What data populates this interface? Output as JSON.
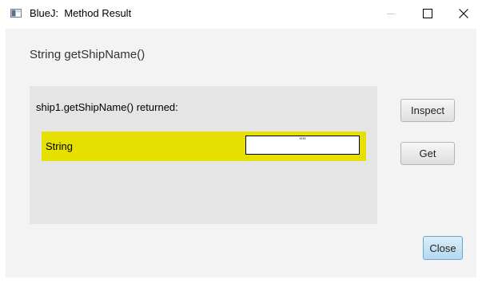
{
  "window": {
    "title": "BlueJ:  Method Result",
    "icon": "bluej-app-icon"
  },
  "titlebar_controls": {
    "minimize_icon": "minimize-icon",
    "maximize_icon": "maximize-icon",
    "close_icon": "close-icon"
  },
  "dialog": {
    "method_signature": "String getShipName()",
    "returned_label": "ship1.getShipName() returned:",
    "result": {
      "type": "String",
      "value": "\"\""
    },
    "buttons": {
      "inspect": "Inspect",
      "get": "Get",
      "close": "Close"
    }
  },
  "colors": {
    "result_highlight": "#e6e000",
    "panel_background": "#e5e5e5",
    "client_background": "#f3f3f3",
    "default_button": "#b3d8ef"
  }
}
